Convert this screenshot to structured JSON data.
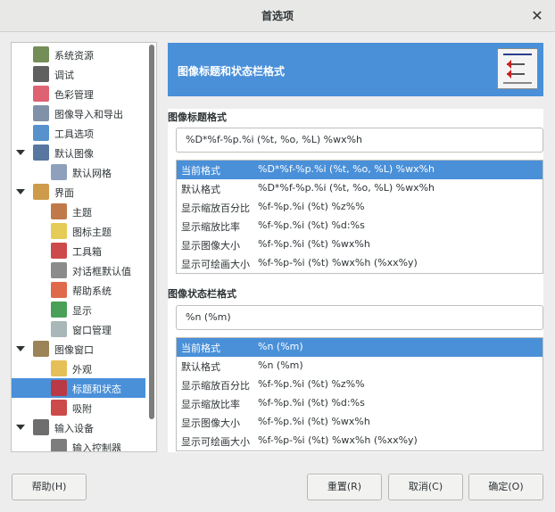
{
  "window": {
    "title": "首选项",
    "close_label": "✕"
  },
  "tree": [
    {
      "label": "系统资源",
      "icon": "system-resources-icon",
      "level": 0,
      "expander": false,
      "selected": false
    },
    {
      "label": "调试",
      "icon": "debug-icon",
      "level": 0,
      "expander": false,
      "selected": false
    },
    {
      "label": "色彩管理",
      "icon": "color-management-icon",
      "level": 0,
      "expander": false,
      "selected": false
    },
    {
      "label": "图像导入和导出",
      "icon": "image-import-export-icon",
      "level": 0,
      "expander": false,
      "selected": false
    },
    {
      "label": "工具选项",
      "icon": "tool-options-icon",
      "level": 0,
      "expander": false,
      "selected": false
    },
    {
      "label": "默认图像",
      "icon": "default-image-icon",
      "level": 0,
      "expander": true,
      "selected": false
    },
    {
      "label": "默认网格",
      "icon": "default-grid-icon",
      "level": 1,
      "expander": false,
      "selected": false
    },
    {
      "label": "界面",
      "icon": "interface-icon",
      "level": 0,
      "expander": true,
      "selected": false
    },
    {
      "label": "主题",
      "icon": "theme-icon",
      "level": 1,
      "expander": false,
      "selected": false
    },
    {
      "label": "图标主题",
      "icon": "icon-theme-icon",
      "level": 1,
      "expander": false,
      "selected": false
    },
    {
      "label": "工具箱",
      "icon": "toolbox-icon",
      "level": 1,
      "expander": false,
      "selected": false
    },
    {
      "label": "对话框默认值",
      "icon": "dialog-defaults-icon",
      "level": 1,
      "expander": false,
      "selected": false
    },
    {
      "label": "帮助系统",
      "icon": "help-system-icon",
      "level": 1,
      "expander": false,
      "selected": false
    },
    {
      "label": "显示",
      "icon": "display-icon",
      "level": 1,
      "expander": false,
      "selected": false
    },
    {
      "label": "窗口管理",
      "icon": "window-management-icon",
      "level": 1,
      "expander": false,
      "selected": false
    },
    {
      "label": "图像窗口",
      "icon": "image-window-icon",
      "level": 0,
      "expander": true,
      "selected": false
    },
    {
      "label": "外观",
      "icon": "appearance-icon",
      "level": 1,
      "expander": false,
      "selected": false
    },
    {
      "label": "标题和状态",
      "icon": "title-status-icon",
      "level": 1,
      "expander": false,
      "selected": true
    },
    {
      "label": "吸附",
      "icon": "snapping-icon",
      "level": 1,
      "expander": false,
      "selected": false
    },
    {
      "label": "输入设备",
      "icon": "input-devices-icon",
      "level": 0,
      "expander": true,
      "selected": false
    },
    {
      "label": "输入控制器",
      "icon": "input-controllers-icon",
      "level": 1,
      "expander": false,
      "selected": false
    }
  ],
  "page": {
    "title": "图像标题和状态栏格式",
    "icon": "title-status-format-icon"
  },
  "title_section": {
    "label": "图像标题格式",
    "value": "%D*%f-%p.%i (%t, %o, %L) %wx%h",
    "formats": [
      {
        "name": "当前格式",
        "value": "%D*%f-%p.%i (%t, %o, %L) %wx%h",
        "selected": true
      },
      {
        "name": "默认格式",
        "value": "%D*%f-%p.%i (%t, %o, %L) %wx%h",
        "selected": false
      },
      {
        "name": "显示缩放百分比",
        "value": "%f-%p.%i (%t) %z%%",
        "selected": false
      },
      {
        "name": "显示缩放比率",
        "value": "%f-%p.%i (%t) %d:%s",
        "selected": false
      },
      {
        "name": "显示图像大小",
        "value": "%f-%p.%i (%t) %wx%h",
        "selected": false
      },
      {
        "name": "显示可绘画大小",
        "value": "%f-%p-%i (%t) %wx%h (%xx%y)",
        "selected": false
      }
    ]
  },
  "status_section": {
    "label": "图像状态栏格式",
    "value": "%n (%m)",
    "formats": [
      {
        "name": "当前格式",
        "value": "%n (%m)",
        "selected": true
      },
      {
        "name": "默认格式",
        "value": "%n (%m)",
        "selected": false
      },
      {
        "name": "显示缩放百分比",
        "value": "%f-%p.%i (%t) %z%%",
        "selected": false
      },
      {
        "name": "显示缩放比率",
        "value": "%f-%p.%i (%t) %d:%s",
        "selected": false
      },
      {
        "name": "显示图像大小",
        "value": "%f-%p.%i (%t) %wx%h",
        "selected": false
      },
      {
        "name": "显示可绘画大小",
        "value": "%f-%p-%i (%t) %wx%h (%xx%y)",
        "selected": false
      }
    ]
  },
  "buttons": {
    "help": "帮助(H)",
    "reset": "重置(R)",
    "cancel": "取消(C)",
    "ok": "确定(O)"
  },
  "colors": {
    "accent": "#4a90d9"
  }
}
